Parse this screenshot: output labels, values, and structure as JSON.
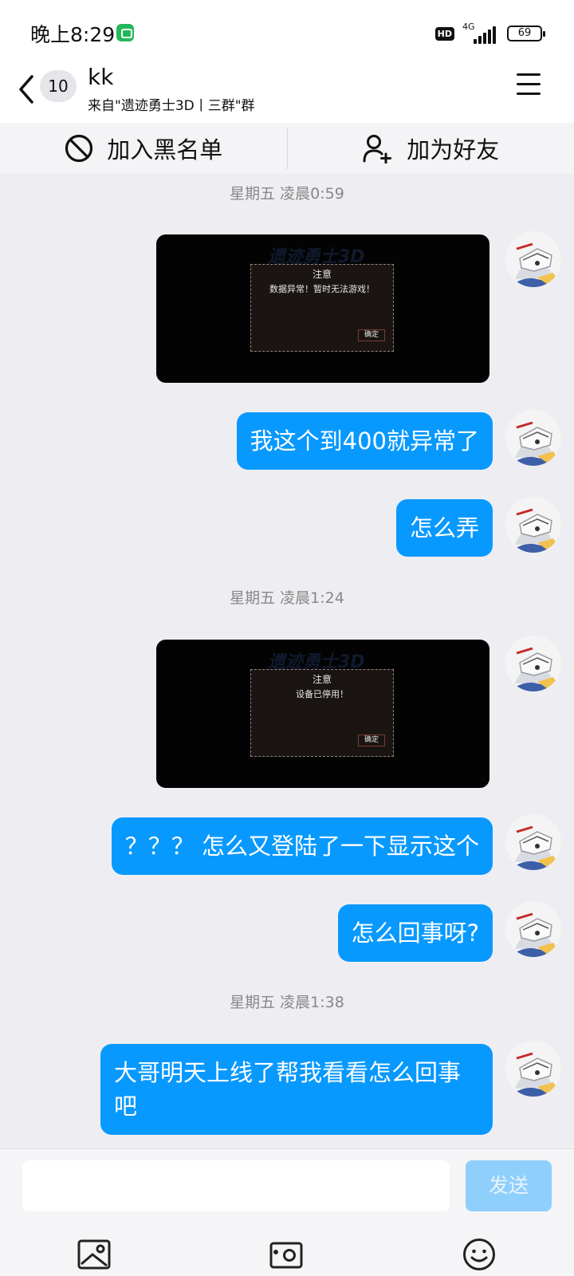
{
  "status_bar": {
    "time": "晚上8:29",
    "hd_label": "HD",
    "network": "4G",
    "battery": "69"
  },
  "header": {
    "unread_count": "10",
    "title": "kk",
    "subtitle": "来自\"遗迹勇士3D丨三群\"群"
  },
  "actions": {
    "blacklist_label": "加入黑名单",
    "add_friend_label": "加为好友"
  },
  "messages": {
    "ts1": "星期五 凌晨0:59",
    "img1": {
      "game_title": "遗迹勇士3D",
      "dialog_title": "注意",
      "dialog_message": "数据异常！暂时无法游戏！",
      "ok_label": "确定"
    },
    "m1": "我这个到400就异常了",
    "m2": "怎么弄",
    "ts2": "星期五 凌晨1:24",
    "img2": {
      "game_title": "遗迹勇士3D",
      "dialog_title": "注意",
      "dialog_message": "设备已停用！",
      "ok_label": "确定"
    },
    "m3": "？？？ 怎么又登陆了一下显示这个",
    "m4": "怎么回事呀?",
    "ts3": "星期五 凌晨1:38",
    "m5": "大哥明天上线了帮我看看怎么回事吧"
  },
  "input": {
    "value": "",
    "send_label": "发送"
  },
  "colors": {
    "bubble": "#0899ff",
    "send_disabled": "#8fcffc",
    "background": "#eeeef2"
  },
  "icons": {
    "back": "chevron-left-icon",
    "menu": "hamburger-menu-icon",
    "blacklist": "block-icon",
    "add_friend": "add-user-icon",
    "photo": "image-icon",
    "camera": "camera-icon",
    "emoji": "emoji-icon"
  }
}
